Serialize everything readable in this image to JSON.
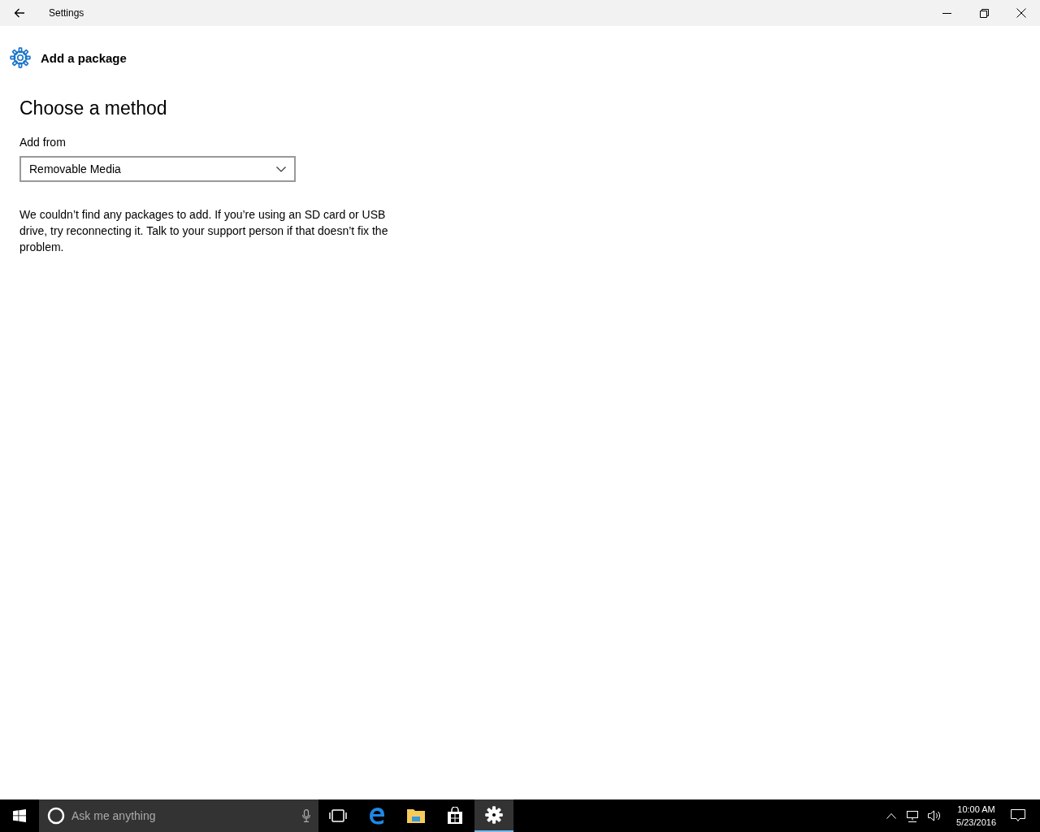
{
  "window": {
    "title": "Settings"
  },
  "page": {
    "title": "Add a package",
    "section_heading": "Choose a method",
    "field_label": "Add from",
    "dropdown_value": "Removable Media",
    "message": "We couldn’t find any packages to add. If you’re using an SD card or USB drive, try reconnecting it. Talk to your support person if that doesn’t fix the problem."
  },
  "taskbar": {
    "search": {
      "placeholder": "Ask me anything"
    },
    "apps": [
      {
        "kind": "taskview",
        "selected": false
      },
      {
        "kind": "browser",
        "selected": false
      },
      {
        "kind": "folder",
        "selected": false
      },
      {
        "kind": "store",
        "selected": false
      },
      {
        "kind": "settings",
        "selected": true
      }
    ],
    "clock": {
      "time": "10:00 AM",
      "date": "5/23/2016"
    }
  }
}
